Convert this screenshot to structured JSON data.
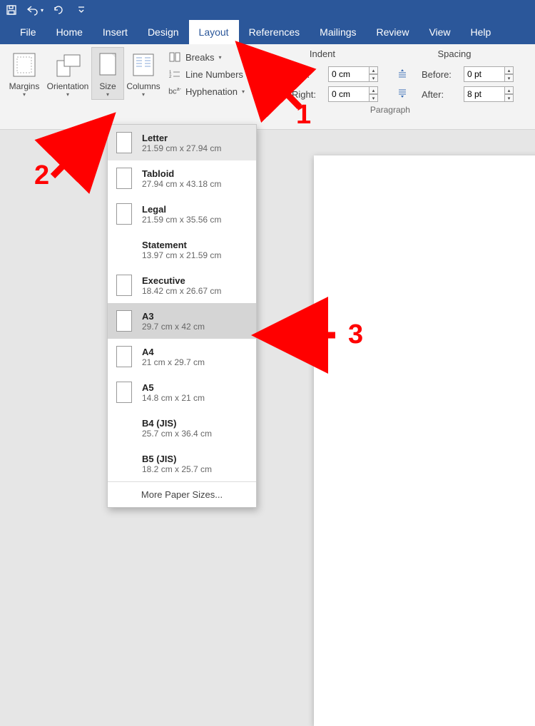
{
  "qat": {
    "save": "save",
    "undo": "undo",
    "redo": "redo"
  },
  "tabs": {
    "items": [
      "File",
      "Home",
      "Insert",
      "Design",
      "Layout",
      "References",
      "Mailings",
      "Review",
      "View",
      "Help"
    ],
    "active_index": 4
  },
  "ribbon": {
    "page_setup": {
      "margins": "Margins",
      "orientation": "Orientation",
      "size": "Size",
      "columns": "Columns",
      "breaks": "Breaks",
      "line_numbers": "Line Numbers",
      "hyphenation": "Hyphenation"
    },
    "paragraph": {
      "group_label": "Paragraph",
      "indent_label": "Indent",
      "spacing_label": "Spacing",
      "left_label": "Left:",
      "right_label": "Right:",
      "before_label": "Before:",
      "after_label": "After:",
      "left_val": "0 cm",
      "right_val": "0 cm",
      "before_val": "0 pt",
      "after_val": "8 pt"
    }
  },
  "size_menu": {
    "items": [
      {
        "name": "Letter",
        "dim": "21.59 cm x 27.94 cm",
        "show_page": true
      },
      {
        "name": "Tabloid",
        "dim": "27.94 cm x 43.18 cm",
        "show_page": true
      },
      {
        "name": "Legal",
        "dim": "21.59 cm x 35.56 cm",
        "show_page": true
      },
      {
        "name": "Statement",
        "dim": "13.97 cm x 21.59 cm",
        "show_page": false
      },
      {
        "name": "Executive",
        "dim": "18.42 cm x 26.67 cm",
        "show_page": true
      },
      {
        "name": "A3",
        "dim": "29.7 cm x 42 cm",
        "show_page": true
      },
      {
        "name": "A4",
        "dim": "21 cm x 29.7 cm",
        "show_page": true
      },
      {
        "name": "A5",
        "dim": "14.8 cm x 21 cm",
        "show_page": true
      },
      {
        "name": "B4 (JIS)",
        "dim": "25.7 cm x 36.4 cm",
        "show_page": false
      },
      {
        "name": "B5 (JIS)",
        "dim": "18.2 cm x 25.7 cm",
        "show_page": false
      }
    ],
    "selected_index": 0,
    "hover_index": 5,
    "footer": "More Paper Sizes..."
  },
  "annotations": {
    "n1": "1",
    "n2": "2",
    "n3": "3"
  }
}
